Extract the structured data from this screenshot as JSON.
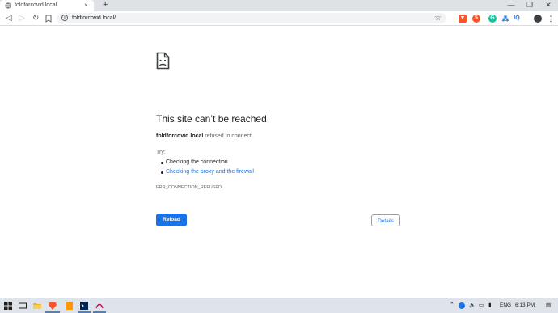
{
  "browser": {
    "tab_title": "foldforcovid.local",
    "tab_close": "×",
    "new_tab": "+",
    "url": "foldforcovid.local/",
    "window_controls": {
      "minimize": "—",
      "maximize": "❐",
      "close": "✕"
    }
  },
  "nav": {
    "back": "◁",
    "forward": "▷",
    "reload": "↻",
    "home": "⌂"
  },
  "extensions": {
    "brave_badge": "5",
    "iq": "IQ"
  },
  "error": {
    "heading": "This site can’t be reached",
    "host": "foldforcovid.local",
    "message_suffix": " refused to connect.",
    "try_label": "Try:",
    "suggestion_1": "Checking the connection",
    "suggestion_2": "Checking the proxy and the firewall",
    "code": "ERR_CONNECTION_REFUSED",
    "reload_label": "Reload",
    "details_label": "Details"
  },
  "taskbar": {
    "language": "ENG",
    "time": "6:13 PM"
  },
  "colors": {
    "accent": "#1a73e8",
    "brave": "#fb542b",
    "grammarly": "#15c39a"
  }
}
